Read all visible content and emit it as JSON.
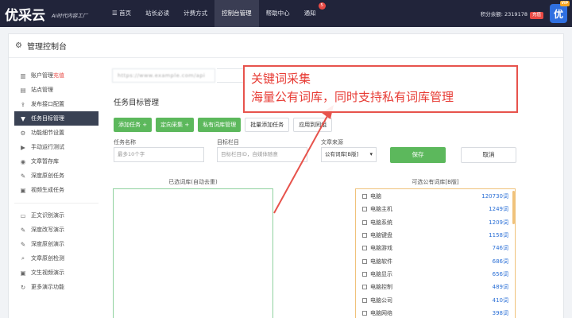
{
  "topbar": {
    "logo_mark": "优采云",
    "slogan": "AI时代内容工厂",
    "nav": [
      {
        "label": "首页",
        "icon": "list-icon"
      },
      {
        "label": "站长必读"
      },
      {
        "label": "计费方式"
      },
      {
        "label": "控制台管理"
      },
      {
        "label": "帮助中心"
      },
      {
        "label": "通知",
        "badge": "5"
      }
    ],
    "points": "积分余额: 2319178",
    "recharge": "充值",
    "vip_mark": "优",
    "vip_badge": "VIP"
  },
  "panel": {
    "title": "管理控制台"
  },
  "sidebar": {
    "items": [
      {
        "label": "账户管理",
        "extra": "充值",
        "icon": "chart-icon"
      },
      {
        "label": "站点管理",
        "icon": "document-icon"
      },
      {
        "label": "发布接口配置",
        "icon": "upload-icon"
      },
      {
        "label": "任务目标管理",
        "icon": "filter-icon",
        "active": true
      },
      {
        "label": "功能细节设置",
        "icon": "gear-icon"
      },
      {
        "label": "手动运行测试",
        "icon": "play-icon"
      },
      {
        "label": "文章暂存库",
        "icon": "database-icon"
      },
      {
        "label": "深度原创任务",
        "icon": "edit-icon"
      },
      {
        "label": "视频生成任务",
        "icon": "video-icon"
      }
    ],
    "demo_items": [
      {
        "label": "正文识别演示",
        "icon": "monitor-icon"
      },
      {
        "label": "深度改写演示",
        "icon": "edit-icon"
      },
      {
        "label": "深度原创演示",
        "icon": "edit-icon"
      },
      {
        "label": "文章原创检测",
        "icon": "search-icon"
      },
      {
        "label": "文生视频演示",
        "icon": "video-icon"
      },
      {
        "label": "更多演示功能",
        "icon": "refresh-icon"
      }
    ]
  },
  "main": {
    "url_text": "https://www.example.com/api",
    "section_title": "任务目标管理",
    "buttons": {
      "add_task": "添加任务 +",
      "directed_collect": "定向采集 +",
      "private_lexicon": "私有词库管理",
      "batch_add": "批量添加任务",
      "apply_group": "应用到同组"
    },
    "form": {
      "task_name_label": "任务名称",
      "task_name_placeholder": "最多10个字",
      "target_label": "目标栏目",
      "target_placeholder": "目标栏目ID，自媒体随意",
      "source_label": "文章来源",
      "source_value": "公有词库[B版]",
      "save": "保存",
      "cancel": "取消"
    },
    "selected_title": "已选词库(自动去重)",
    "public_title": "可选公有词库[B版]",
    "keywords": [
      {
        "kw": "电脑",
        "count": "120730词"
      },
      {
        "kw": "电脑主机",
        "count": "1249词"
      },
      {
        "kw": "电脑系统",
        "count": "1209词"
      },
      {
        "kw": "电脑键盘",
        "count": "1158词"
      },
      {
        "kw": "电脑游戏",
        "count": "746词"
      },
      {
        "kw": "电脑软件",
        "count": "686词"
      },
      {
        "kw": "电脑显示",
        "count": "656词"
      },
      {
        "kw": "电脑控制",
        "count": "489词"
      },
      {
        "kw": "电脑公司",
        "count": "410词"
      },
      {
        "kw": "电脑网络",
        "count": "398词"
      }
    ]
  },
  "callout": {
    "line1": "关键词采集",
    "line2": "海量公有词库，同时支持私有词库管理"
  },
  "colors": {
    "topbar": "#21243a",
    "green": "#5cb85c",
    "accent_red": "#e84a45",
    "link_blue": "#2a6fd6"
  }
}
